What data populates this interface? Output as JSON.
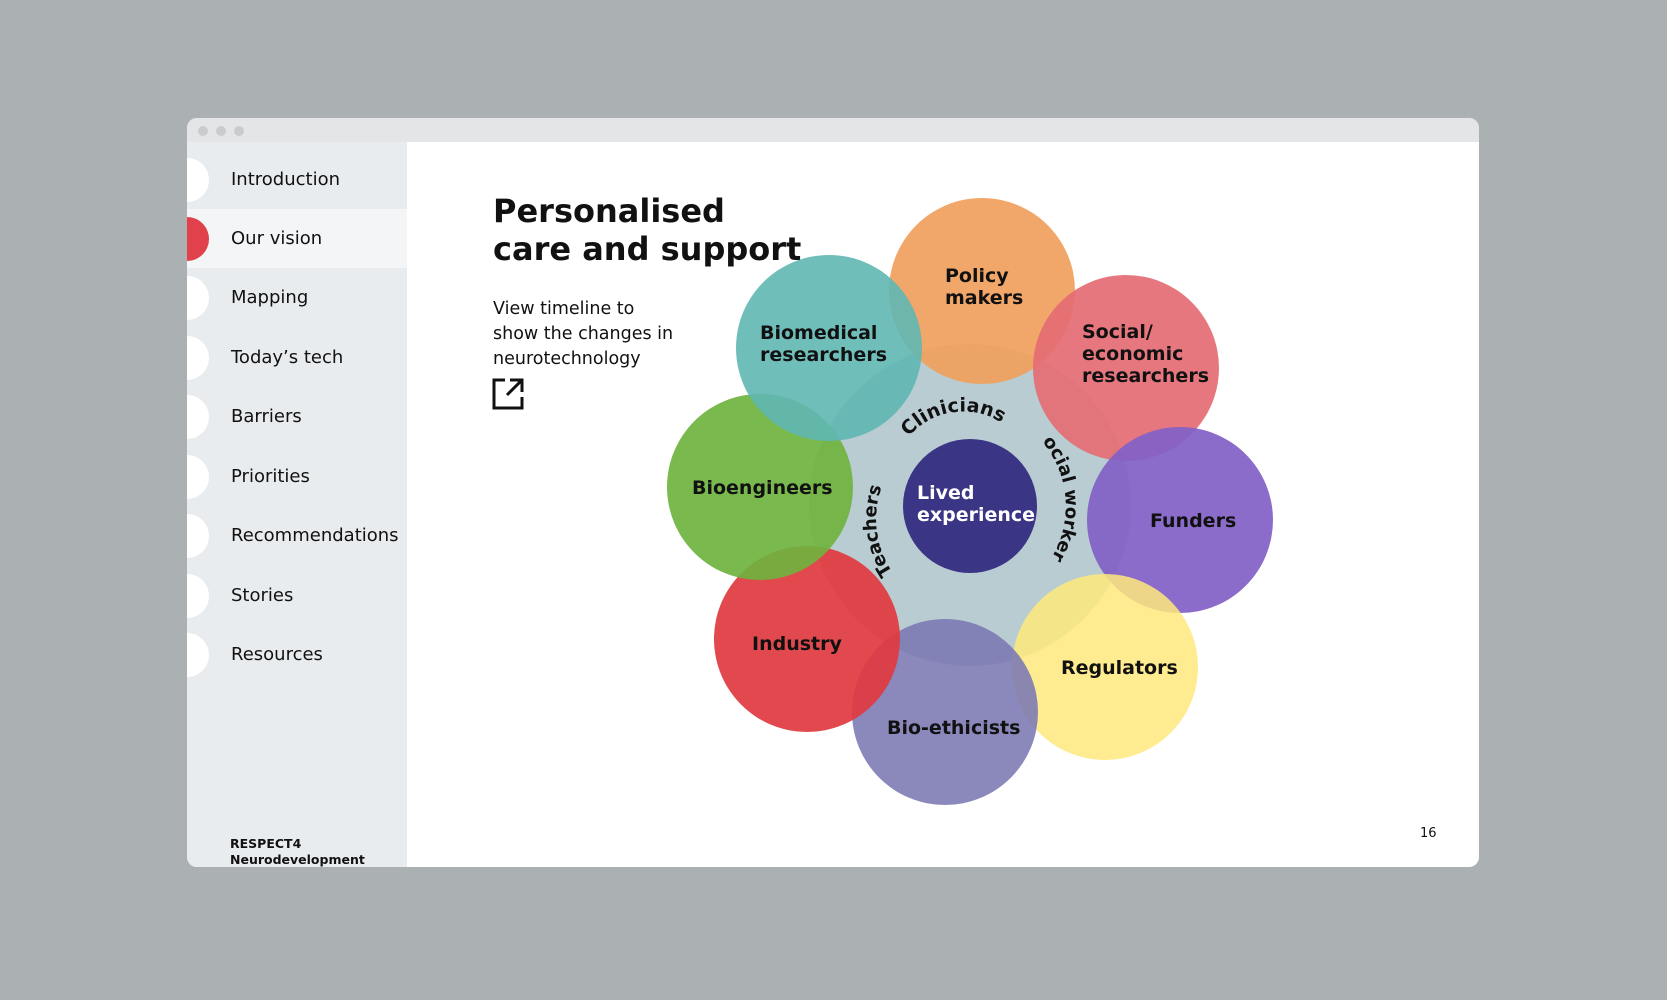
{
  "sidebar": {
    "items": [
      {
        "label": "Introduction",
        "active": false
      },
      {
        "label": "Our vision",
        "active": true
      },
      {
        "label": "Mapping",
        "active": false
      },
      {
        "label": "Today’s tech",
        "active": false
      },
      {
        "label": "Barriers",
        "active": false
      },
      {
        "label": "Priorities",
        "active": false
      },
      {
        "label": "Recommendations",
        "active": false
      },
      {
        "label": "Stories",
        "active": false
      },
      {
        "label": "Resources",
        "active": false
      }
    ],
    "brand_line1": "RESPECT4",
    "brand_line2": "Neurodevelopment"
  },
  "main": {
    "title_line1": "Personalised",
    "title_line2": "care and support",
    "note_line1": "View timeline to",
    "note_line2": "show the changes in",
    "note_line3": "neurotechnology",
    "link_icon": "external-link-icon",
    "page_number": "16"
  },
  "diagram": {
    "center": {
      "label_line1": "Lived",
      "label_line2": "experience",
      "color": "#3b3585"
    },
    "inner_ring": {
      "color": "#b9ccd2",
      "labels": {
        "top": "Clinicians",
        "right": "Social workers",
        "left": "Teachers"
      }
    },
    "petals": {
      "policy": {
        "line1": "Policy",
        "line2": "makers",
        "color": "#f0a05e"
      },
      "social": {
        "line1": "Social/",
        "line2": "economic",
        "line3": "researchers",
        "color": "#e56d74"
      },
      "funders": {
        "line1": "Funders",
        "color": "#8261c6"
      },
      "regulators": {
        "line1": "Regulators",
        "color": "#ffe97d"
      },
      "bioethicists": {
        "line1": "Bio-ethicists",
        "color": "#7b78b3"
      },
      "industry": {
        "line1": "Industry",
        "color": "#e0393f"
      },
      "bioengineers": {
        "line1": "Bioengineers",
        "color": "#6fb33e"
      },
      "biomedical": {
        "line1": "Biomedical",
        "line2": "researchers",
        "color": "#5fb7b3"
      }
    }
  }
}
